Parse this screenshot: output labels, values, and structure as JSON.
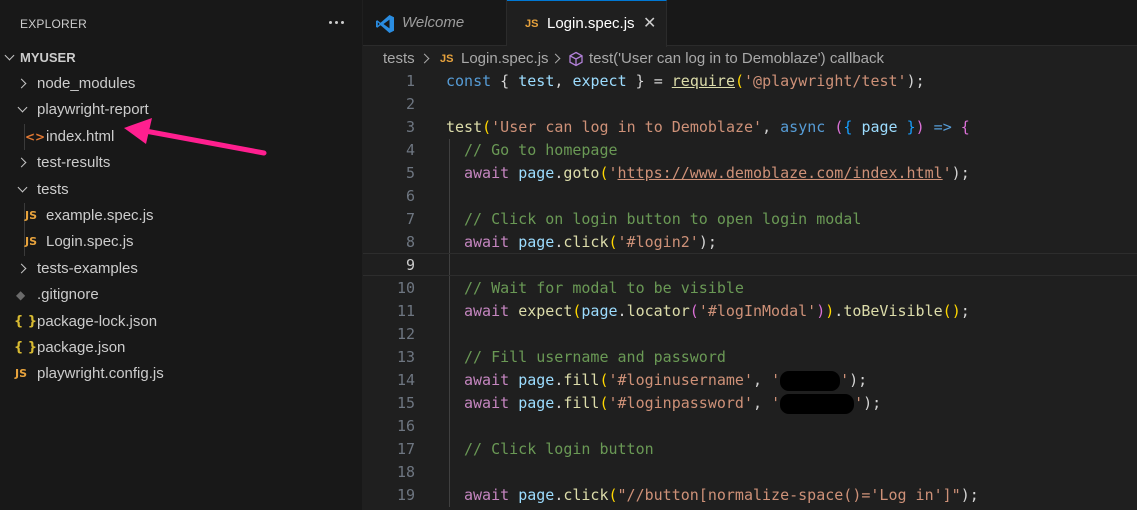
{
  "sidebar": {
    "title": "EXPLORER",
    "root": "MYUSER",
    "items": [
      {
        "label": "node_modules",
        "type": "folder"
      },
      {
        "label": "playwright-report",
        "type": "folder"
      },
      {
        "label": "index.html",
        "type": "html"
      },
      {
        "label": "test-results",
        "type": "folder"
      },
      {
        "label": "tests",
        "type": "folder"
      },
      {
        "label": "example.spec.js",
        "type": "js"
      },
      {
        "label": "Login.spec.js",
        "type": "js"
      },
      {
        "label": "tests-examples",
        "type": "folder"
      },
      {
        "label": ".gitignore",
        "type": "git"
      },
      {
        "label": "package-lock.json",
        "type": "json"
      },
      {
        "label": "package.json",
        "type": "json"
      },
      {
        "label": "playwright.config.js",
        "type": "js"
      }
    ],
    "icons": {
      "js": "JS",
      "html": "<>",
      "json": "{ }",
      "git": "◆"
    }
  },
  "tabs": [
    {
      "label": "Welcome",
      "icon": "vscode-icon"
    },
    {
      "label": "Login.spec.js",
      "icon": "js-icon",
      "badge": "JS",
      "close": "✕"
    }
  ],
  "breadcrumb": {
    "folder": "tests",
    "file": "Login.spec.js",
    "file_badge": "JS",
    "symbol": "test('User can log in to Demoblaze') callback"
  },
  "code": {
    "line_numbers": [
      "1",
      "2",
      "3",
      "4",
      "5",
      "6",
      "7",
      "8",
      "9",
      "10",
      "11",
      "12",
      "13",
      "14",
      "15",
      "16",
      "17",
      "18",
      "19"
    ],
    "active_line": "9",
    "lines": {
      "l1": [
        "const",
        " { ",
        "test",
        ", ",
        "expect",
        " } = ",
        "require",
        "(",
        "'@playwright/test'",
        ");"
      ],
      "l3": [
        "test",
        "(",
        "'User can log in to Demoblaze'",
        ", ",
        "async",
        " (",
        "{ ",
        "page",
        " }",
        ")",
        " => ",
        "{"
      ],
      "l4": "// Go to homepage",
      "l5": [
        "await",
        " ",
        "page",
        ".",
        "goto",
        "(",
        "'",
        "https://www.demoblaze.com/index.html",
        "'",
        ");"
      ],
      "l7": "// Click on login button to open login modal",
      "l8": [
        "await",
        " ",
        "page",
        ".",
        "click",
        "(",
        "'#login2'",
        ");"
      ],
      "l10": "// Wait for modal to be visible",
      "l11": [
        "await",
        " ",
        "expect",
        "(",
        "page",
        ".",
        "locator",
        "(",
        "'#logInModal'",
        ")",
        ")",
        ".",
        "toBeVisible",
        "(",
        ")",
        ";"
      ],
      "l13": "// Fill username and password",
      "l14": [
        "await",
        " ",
        "page",
        ".",
        "fill",
        "(",
        "'#loginusername'",
        ", ",
        "'",
        "'",
        ");"
      ],
      "l15": [
        "await",
        " ",
        "page",
        ".",
        "fill",
        "(",
        "'#loginpassword'",
        ", ",
        "'",
        "'",
        ");"
      ],
      "l17": "// Click login button",
      "l19": [
        "await",
        " ",
        "page",
        ".",
        "click",
        "(",
        "\"//button[normalize-space()='Log in']\"",
        ");"
      ]
    }
  },
  "colors": {
    "keyword": "#569cd6",
    "control": "#c586c0",
    "variable": "#9cdcfe",
    "function": "#dcdcaa",
    "string": "#ce9178",
    "comment": "#6a9955",
    "accent": "#0078d4",
    "arrow": "#ff1f8f"
  }
}
